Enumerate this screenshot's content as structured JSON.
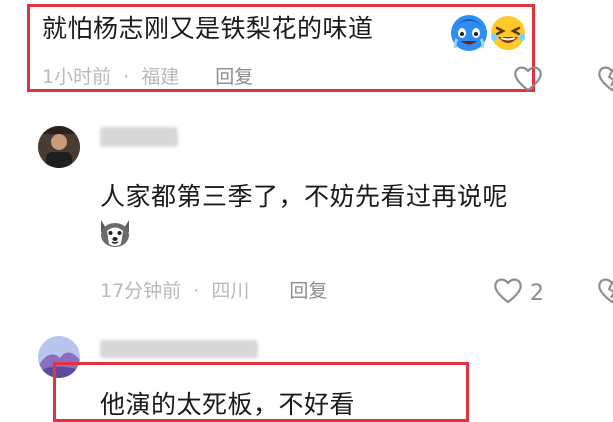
{
  "comments": [
    {
      "text": "就怕杨志刚又是铁梨花的味道",
      "time": "1小时前",
      "separator": "·",
      "location": "福建",
      "reply_label": "回复",
      "emojis": [
        "cry-laugh-emoji",
        "grin-squint-emoji"
      ]
    },
    {
      "text": "人家都第三季了，不妨先看过再说呢",
      "time": "17分钟前",
      "separator": "·",
      "location": "四川",
      "reply_label": "回复",
      "like_count": "2",
      "emojis": [
        "husky-dog-emoji"
      ]
    },
    {
      "text": "他演的太死板，不好看"
    }
  ],
  "colors": {
    "highlight_border": "#e0333f",
    "meta_text": "#b9b9b9",
    "icon_gray": "#8c8c8c"
  }
}
